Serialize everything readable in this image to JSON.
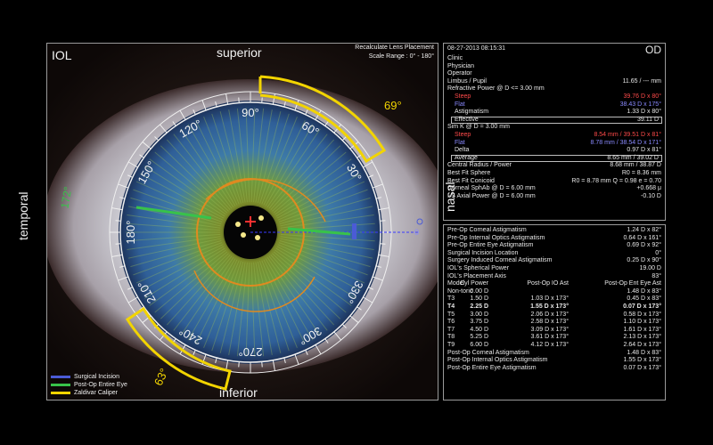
{
  "left": {
    "mode": "IOL",
    "recalc": "Recalculate Lens Placement",
    "scale_range": "Scale Range : 0° - 180°",
    "superior": "superior",
    "inferior": "inferior",
    "temporal": "temporal",
    "nasal": "nasal",
    "angles": [
      "90°",
      "60°",
      "30°",
      "0",
      "330°",
      "300°",
      "270°",
      "240°",
      "210°",
      "180°",
      "150°",
      "120°"
    ],
    "caliper_labels": {
      "top": "69°",
      "bottom": "63°",
      "left": "172°"
    },
    "nasal_zero": "0",
    "legend": [
      {
        "label": "Surgical Incision",
        "color": "#4b5bd6"
      },
      {
        "label": "Post-Op Entire Eye",
        "color": "#38c24a"
      },
      {
        "label": "Zaldivar Caliper",
        "color": "#f2d400"
      }
    ]
  },
  "top": {
    "datetime": "08-27-2013  08:15:31",
    "eye": "OD",
    "clinic": "Clinic",
    "physician": "Physician",
    "operator": "Operator",
    "limbus_label": "Limbus / Pupil",
    "limbus_value": "11.65 / --- mm",
    "refr_label": "Refractive Power @ D <= 3.00 mm",
    "steep1_label": "Steep",
    "steep1_value": "39.76 D x  80°",
    "flat1_label": "Flat",
    "flat1_value": "38.43 D x 175°",
    "astig1_label": "Astigmatism",
    "astig1_value": "1.33 D x  80°",
    "eff_label": "Effective",
    "eff_value": "39.11 D",
    "simk_label": "Sim K @ D = 3.00 mm",
    "steep2_label": "Steep",
    "steep2_value": "8.54 mm / 39.51 D x  81°",
    "flat2_label": "Flat",
    "flat2_value": "8.78 mm / 38.54 D x 171°",
    "delta_label": "Delta",
    "delta_value": "0.97 D x  81°",
    "avg_label": "Average",
    "avg_value": "8.65 mm / 39.02 D",
    "central_label": "Central Radius / Power",
    "central_value": "8.68 mm / 38.87 D",
    "bfs_label": "Best Fit Sphere",
    "bfs_value": "R0 = 8.36 mm",
    "bfc_label": "Best Fit Conicoid",
    "bfc_value": "R0 = 8.78 mm  Q = 0.98  e = 0.70",
    "sphab_label": "Corneal SphAb @ D = 6.00 mm",
    "sphab_value": "+0.668 μ",
    "isaxial_label": "I-S Axial Power @ D = 6.00 mm",
    "isaxial_value": "-0.10 D"
  },
  "bottom": {
    "rows": [
      {
        "label": "Pre-Op Corneal Astigmatism",
        "value": "1.24 D x  82°"
      },
      {
        "label": "Pre-Op Internal Optics Astigmatism",
        "value": "0.64 D x 161°"
      },
      {
        "label": "Pre-Op Entire Eye Astigmatism",
        "value": "0.69 D x  92°"
      },
      {
        "label": "Surgical Incision Location",
        "value": "0°"
      },
      {
        "label": "Surgery Induced Corneal Astigmatism",
        "value": "0.25 D x  90°"
      },
      {
        "label": "IOL's Spherical Power",
        "value": "19.00 D"
      },
      {
        "label": "IOL's Placement Axis",
        "value": "83°"
      }
    ],
    "table_headers": [
      "Model",
      "Cyl Power",
      "Post-Op IO Ast",
      "Post-Op Ent Eye Ast"
    ],
    "table": [
      [
        "Non-toric",
        "0.00 D",
        "",
        "1.48 D x  83°"
      ],
      [
        "T3",
        "1.50 D",
        "1.03 D x 173°",
        "0.45 D x  83°"
      ],
      [
        "T4",
        "2.25 D",
        "1.55 D x 173°",
        "0.07 D x 173°"
      ],
      [
        "T5",
        "3.00 D",
        "2.06 D x 173°",
        "0.58 D x 173°"
      ],
      [
        "T6",
        "3.75 D",
        "2.58 D x 173°",
        "1.10 D x 173°"
      ],
      [
        "T7",
        "4.50 D",
        "3.09 D x 173°",
        "1.61 D x 173°"
      ],
      [
        "T8",
        "5.25 D",
        "3.61 D x 173°",
        "2.13 D x 173°"
      ],
      [
        "T9",
        "6.00 D",
        "4.12 D x 173°",
        "2.64 D x 173°"
      ]
    ],
    "post_rows": [
      {
        "label": "Post-Op Corneal Astigmatism",
        "value": "1.48 D x  83°"
      },
      {
        "label": "Post-Op Internal Optics Astigmatism",
        "value": "1.55 D x 173°"
      },
      {
        "label": "Post-Op Entire Eye Astigmatism",
        "value": "0.07 D x 173°"
      }
    ]
  }
}
